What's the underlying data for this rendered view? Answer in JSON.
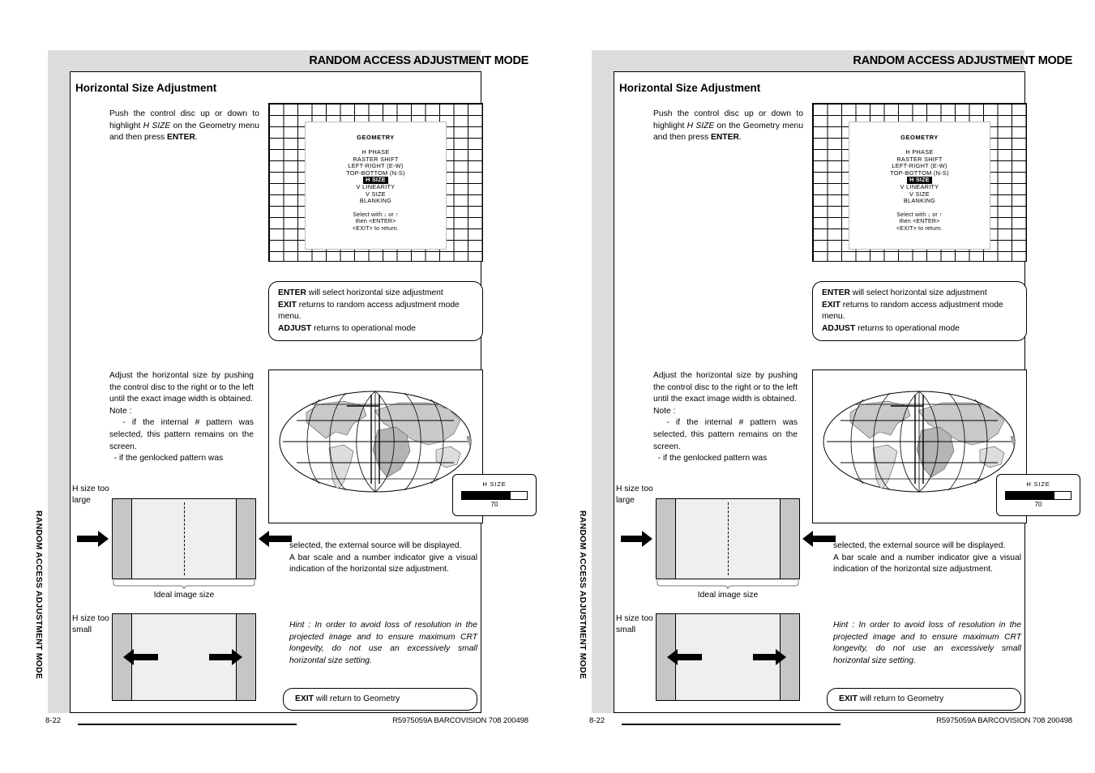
{
  "document": {
    "header_title": "RANDOM ACCESS ADJUSTMENT MODE",
    "sidebar_vertical_label": "RANDOM ACCESS ADJUSTMENT MODE",
    "section_title": "Horizontal Size Adjustment",
    "footer": {
      "page_number": "8-22",
      "reference": "R5975059A BARCOVISION 708 200498"
    }
  },
  "body": {
    "intro_paragraph_html": "Push the control disc up or down to highlight <i>H SIZE</i> on the Geometry menu and then press <b>ENTER</b>.",
    "adjust_paragraph_html": "Adjust the horizontal size by pushing the control disc to the right or to the left until the exact image width is obtained.<br>Note :<br>&nbsp;&nbsp;- if the internal # pattern was selected, this pattern remains on the screen.<br>&nbsp;&nbsp;- if the genlocked pattern was",
    "continued_paragraph_html": "selected, the external source will be displayed.<br>A bar scale and a number indicator give a visual indication of the horizontal size adjustment.",
    "hint_html": "Hint : In order to avoid loss of resolution in the projected image and to ensure maximum CRT longevity, do not use an excessively small horizontal size setting."
  },
  "osd_menu": {
    "title": "GEOMETRY",
    "items": [
      {
        "label": "H PHASE",
        "highlighted": false
      },
      {
        "label": "RASTER SHIFT",
        "highlighted": false
      },
      {
        "label": "LEFT-RIGHT (E-W)",
        "highlighted": false
      },
      {
        "label": "TOP-BOTTOM (N-S)",
        "highlighted": false
      },
      {
        "label": "H SIZE",
        "highlighted": true
      },
      {
        "label": "V LINEARITY",
        "highlighted": false
      },
      {
        "label": "V SIZE",
        "highlighted": false
      },
      {
        "label": "BLANKING",
        "highlighted": false
      }
    ],
    "footer_line1": "Select with  ↓ or ↑",
    "footer_line2": "then <ENTER>",
    "footer_line3": "<EXIT>  to  return."
  },
  "callout_keys": {
    "line1_html": "<b>ENTER</b> will select horizontal size adjustment",
    "line2_html": "<b>EXIT</b> returns to random access adjustment mode menu.",
    "line3_html": "<b>ADJUST</b> returns to operational mode",
    "exit_geometry_html": "<b>EXIT</b> will return to Geometry"
  },
  "h_size_indicator": {
    "label": "H SIZE",
    "value": "70",
    "bar_fill_percent": 75
  },
  "diagrams": {
    "too_large_label": "H size too large",
    "too_small_label": "H size too small",
    "ideal_label": "Ideal image size"
  },
  "colors": {
    "gray_band": "#dcdcdc",
    "diagram_side": "#c6c6c6",
    "diagram_fill": "#efefef",
    "ink": "#000000"
  }
}
